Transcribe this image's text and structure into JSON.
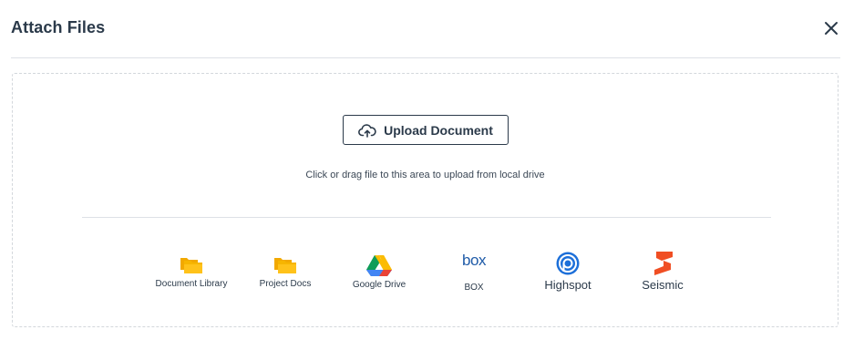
{
  "dialog": {
    "title": "Attach Files",
    "close_label": "×"
  },
  "upload": {
    "button_label": "Upload Document",
    "hint": "Click or drag file to this area to upload from local drive"
  },
  "sources": [
    {
      "label": "Document Library",
      "icon": "folder-icon"
    },
    {
      "label": "Project Docs",
      "icon": "folder-icon"
    },
    {
      "label": "Google Drive",
      "icon": "google-drive-icon"
    },
    {
      "label": "BOX",
      "logo_text": "box",
      "icon": "box-logo-icon"
    },
    {
      "label": "Highspot",
      "icon": "highspot-icon"
    },
    {
      "label": "Seismic",
      "icon": "seismic-icon"
    }
  ],
  "colors": {
    "folder": "#f7b500",
    "box_blue": "#1f5ba8",
    "highspot_blue": "#1c6fd9",
    "seismic_orange": "#f04e23",
    "text_dark": "#2b3a4a"
  }
}
